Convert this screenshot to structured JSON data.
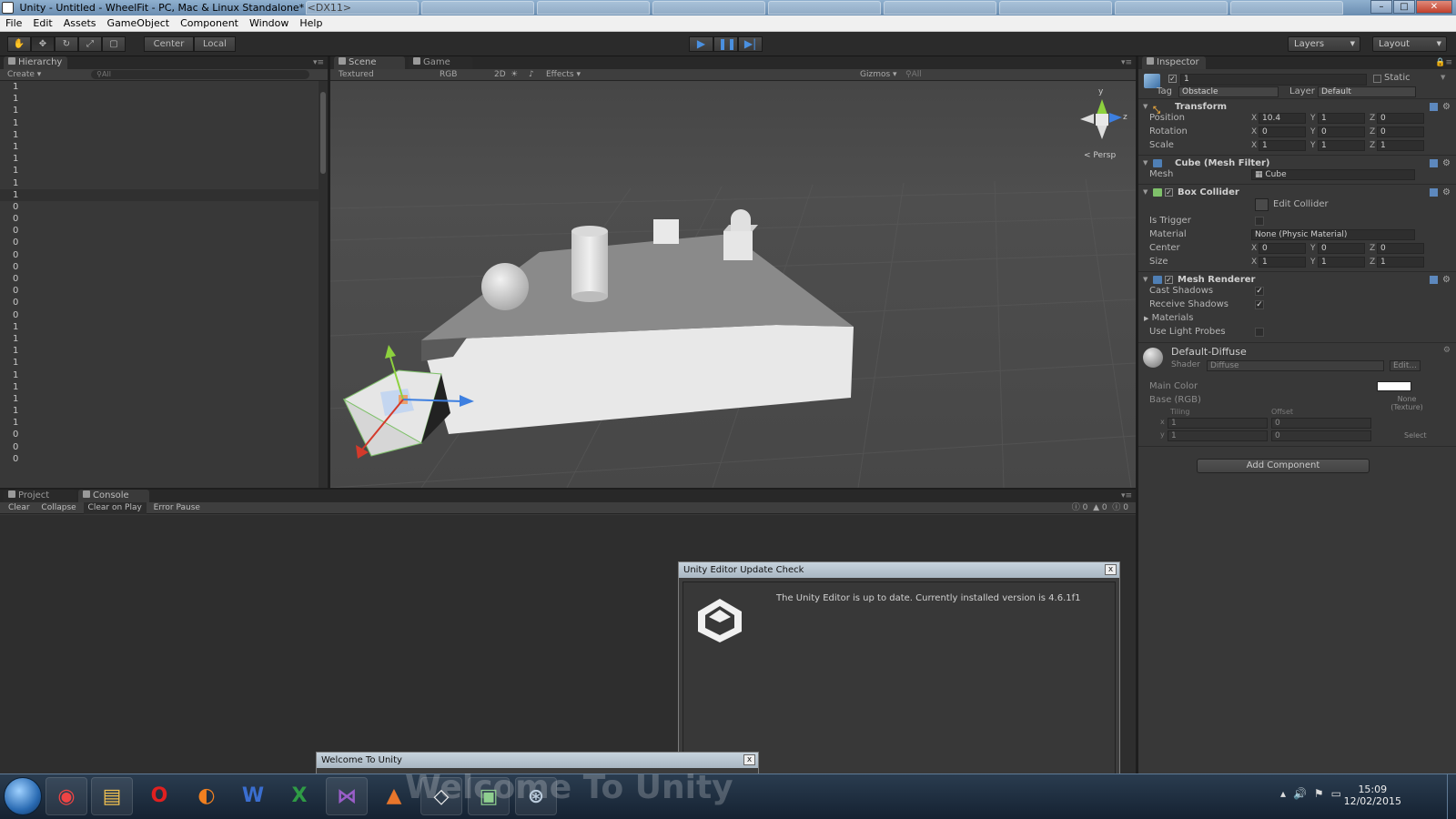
{
  "window": {
    "title": "Unity - Untitled - WheelFit - PC, Mac & Linux Standalone* <DX11>",
    "minimize": "–",
    "maximize": "□",
    "close": "✕"
  },
  "menu": [
    "File",
    "Edit",
    "Assets",
    "GameObject",
    "Component",
    "Window",
    "Help"
  ],
  "toolbar": {
    "pivot": "Center",
    "space": "Local",
    "layers": "Layers",
    "layout": "Layout",
    "tool_icons": [
      "hand-icon",
      "move-icon",
      "rotate-icon",
      "scale-icon",
      "rect-icon"
    ],
    "play_icons": [
      "play-icon",
      "pause-icon",
      "step-icon"
    ]
  },
  "hierarchy": {
    "tab": "Hierarchy",
    "create": "Create",
    "search_placeholder": "All",
    "rows": [
      "1",
      "1",
      "1",
      "1",
      "1",
      "1",
      "1",
      "1",
      "1",
      "1",
      "0",
      "0",
      "0",
      "0",
      "0",
      "0",
      "0",
      "0",
      "0",
      "0",
      "1",
      "1",
      "1",
      "1",
      "1",
      "1",
      "1",
      "1",
      "1",
      "0",
      "0",
      "0"
    ],
    "selected_index": 9
  },
  "scene": {
    "tab_scene": "Scene",
    "tab_game": "Game",
    "shading": "Textured",
    "render": "RGB",
    "mode2d": "2D",
    "effects": "Effects",
    "gizmos": "Gizmos",
    "search_placeholder": "All",
    "gizmo_y": "y",
    "gizmo_z": "z",
    "persp": "Persp"
  },
  "inspector": {
    "tab": "Inspector",
    "object_name": "1",
    "static": "Static",
    "tag_label": "Tag",
    "tag": "Obstacle",
    "layer_label": "Layer",
    "layer": "Default",
    "transform": {
      "title": "Transform",
      "position_label": "Position",
      "position": {
        "x": "10.4",
        "y": "1",
        "z": "0"
      },
      "rotation_label": "Rotation",
      "rotation": {
        "x": "0",
        "y": "0",
        "z": "0"
      },
      "scale_label": "Scale",
      "scale": {
        "x": "1",
        "y": "1",
        "z": "1"
      }
    },
    "mesh_filter": {
      "title": "Cube (Mesh Filter)",
      "mesh_label": "Mesh",
      "mesh": "Cube"
    },
    "box_collider": {
      "title": "Box Collider",
      "edit": "Edit Collider",
      "trigger_label": "Is Trigger",
      "material_label": "Material",
      "material": "None (Physic Material)",
      "center_label": "Center",
      "center": {
        "x": "0",
        "y": "0",
        "z": "0"
      },
      "size_label": "Size",
      "size": {
        "x": "1",
        "y": "1",
        "z": "1"
      }
    },
    "mesh_renderer": {
      "title": "Mesh Renderer",
      "cast_label": "Cast Shadows",
      "receive_label": "Receive Shadows",
      "materials_label": "Materials",
      "probes_label": "Use Light Probes"
    },
    "material": {
      "name": "Default-Diffuse",
      "shader_label": "Shader",
      "shader": "Diffuse",
      "edit": "Edit...",
      "main_color_label": "Main Color",
      "base_label": "Base (RGB)",
      "tiling_label": "Tiling",
      "offset_label": "Offset",
      "tx": "1",
      "ty": "1",
      "ox": "0",
      "oy": "0",
      "none": "None",
      "texture": "(Texture)",
      "select": "Select",
      "axis_x": "x",
      "axis_y": "y"
    },
    "add_component": "Add Component",
    "axis": {
      "x": "X",
      "y": "Y",
      "z": "Z"
    }
  },
  "console": {
    "tab_project": "Project",
    "tab_console": "Console",
    "buttons": [
      "Clear",
      "Collapse",
      "Clear on Play",
      "Error Pause"
    ],
    "counts": {
      "errors": "0",
      "warnings": "0",
      "logs": "0"
    }
  },
  "update_dialog": {
    "title": "Unity Editor Update Check",
    "message": "The Unity Editor is up to date. Currently installed version is 4.6.1f1",
    "close": "x"
  },
  "welcome_dialog": {
    "title": "Welcome To Unity",
    "close": "x",
    "banner": "Welcome To Unity"
  },
  "taskbar": {
    "apps": [
      "chrome-icon",
      "folder-icon",
      "opera-icon",
      "firefox-icon",
      "word-icon",
      "excel-icon",
      "visual-studio-icon",
      "matlab-icon",
      "unity-icon",
      "terminal-icon",
      "network-icon"
    ],
    "time": "15:09",
    "date": "12/02/2015"
  },
  "colors": {
    "accent": "#4a90e0",
    "selection": "#3e5f8a"
  }
}
